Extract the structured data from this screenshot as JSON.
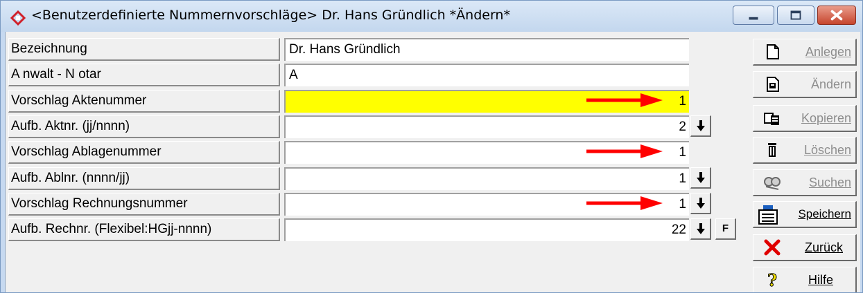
{
  "window": {
    "title": "<Benutzerdefinierte Nummernvorschläge> Dr. Hans Gründlich *Ändern*"
  },
  "rows": [
    {
      "label": "Bezeichnung",
      "value": "Dr. Hans Gründlich"
    },
    {
      "label": "A nwalt - N otar",
      "value": "A"
    },
    {
      "label": "Vorschlag Aktenummer",
      "value": "1"
    },
    {
      "label": "Aufb. Aktnr. (jj/nnnn)",
      "value": "2"
    },
    {
      "label": "Vorschlag Ablagenummer",
      "value": "1"
    },
    {
      "label": "Aufb. Ablnr. (nnnn/jj)",
      "value": "1"
    },
    {
      "label": "Vorschlag Rechnungsnummer",
      "value": "1"
    },
    {
      "label": "Aufb. Rechnr. (Flexibel:HGjj-nnnn)",
      "value": "22"
    }
  ],
  "small_buttons": {
    "f_label": "F"
  },
  "sidebar": [
    {
      "label": "Anlegen",
      "icon": "new-document-icon",
      "enabled": false
    },
    {
      "label": "Ändern",
      "icon": "edit-document-icon",
      "enabled": false
    },
    {
      "label": "Kopieren",
      "icon": "copy-icon",
      "enabled": false
    },
    {
      "label": "Löschen",
      "icon": "trash-icon",
      "enabled": false
    },
    {
      "label": "Suchen",
      "icon": "search-binoculars-icon",
      "enabled": false
    },
    {
      "label": "Speichern",
      "icon": "save-printer-icon",
      "enabled": true
    },
    {
      "label": "Zurück",
      "icon": "red-x-icon",
      "enabled": true
    },
    {
      "label": "Hilfe",
      "icon": "question-mark-icon",
      "enabled": true
    }
  ],
  "colors": {
    "highlight_field": "#ffff00",
    "annotation_arrow": "#ff0000"
  }
}
